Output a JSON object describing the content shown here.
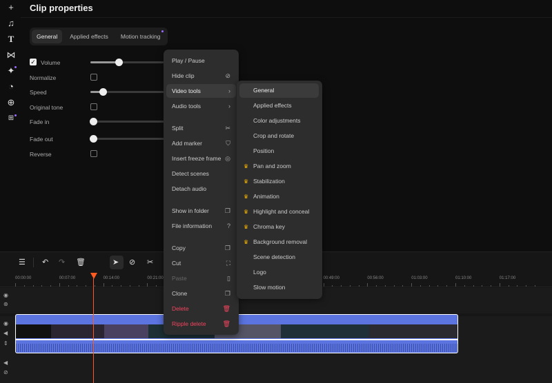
{
  "sidebar": {
    "items": [
      "add-icon",
      "music-icon",
      "text-icon",
      "transition-icon",
      "effects-icon",
      "sticker-icon",
      "plugins-icon",
      "apps-icon"
    ]
  },
  "header": {
    "title": "Clip properties"
  },
  "tabs": [
    "General",
    "Applied effects",
    "Motion tracking"
  ],
  "properties": {
    "volume": "Volume",
    "volume_level": 0.37,
    "normalize": "Normalize",
    "speed": "Speed",
    "speed_level": 0.16,
    "original_tone": "Original tone",
    "fade_in": "Fade in",
    "fade_out": "Fade out",
    "reverse": "Reverse"
  },
  "context_menu": {
    "items": [
      "Play / Pause",
      "Hide clip",
      "Video tools",
      "Audio tools",
      "Split",
      "Add marker",
      "Insert freeze frame",
      "Detect scenes",
      "Detach audio",
      "Show in folder",
      "File information",
      "Copy",
      "Cut",
      "Paste",
      "Clone",
      "Delete",
      "Ripple delete"
    ]
  },
  "submenu": {
    "items": [
      "General",
      "Applied effects",
      "Color adjustments",
      "Crop and rotate",
      "Position",
      "Pan and zoom",
      "Stabilization",
      "Animation",
      "Highlight and conceal",
      "Chroma key",
      "Background removal",
      "Scene detection",
      "Logo",
      "Slow motion"
    ],
    "premium": [
      false,
      false,
      false,
      false,
      false,
      true,
      true,
      true,
      true,
      true,
      true,
      false,
      false,
      false
    ]
  },
  "timeline": {
    "ticks": [
      "00:00:00",
      "00:07:00",
      "00:14:00",
      "00:21:00",
      "",
      "",
      "",
      "00:49:00",
      "00:56:00",
      "01:03:00",
      "01:10:00",
      "01:17:00"
    ],
    "playhead_color": "#ff5a1f",
    "clip_color": "#5b74e0"
  },
  "colors": {
    "danger": "#f0455e",
    "accent": "#9b6bff",
    "premium": "#f5b400"
  }
}
